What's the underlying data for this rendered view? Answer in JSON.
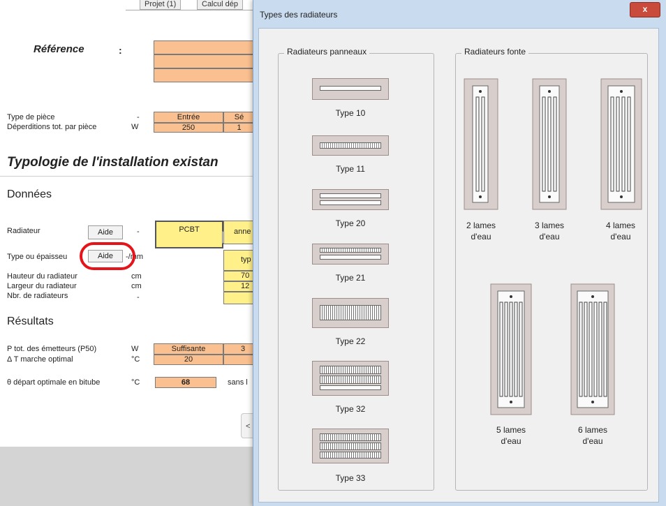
{
  "sheet": {
    "tabs": [
      "Projet (1)",
      "Calcul dép"
    ],
    "reference_label": "Référence",
    "reference_colon": ":",
    "type_piece_label": "Type de pièce",
    "type_piece_unit": "-",
    "type_piece_values": [
      "Entrée",
      "Sé"
    ],
    "deperditions_label": "Déperditions tot. par pièce",
    "deperditions_unit": "W",
    "deperditions_values": [
      "250",
      "1"
    ],
    "section_title": "Typologie de l'installation existan",
    "donnees_title": "Données",
    "radiateur_label": "Radiateur",
    "aide_label": "Aide",
    "radiateur_unit": "-",
    "radiateur_value": "PCBT",
    "radiateur_next": "anne",
    "type_epaisseur_label": "Type ou épaisseu",
    "type_epaisseur_unit": "-/mm",
    "type_epaisseur_value": "typ",
    "hauteur_label": "Hauteur du radiateur",
    "hauteur_unit": "cm",
    "hauteur_value": "70",
    "largeur_label": "Largeur du radiateur",
    "largeur_unit": "cm",
    "largeur_value": "12",
    "nbr_label": "Nbr. de radiateurs",
    "nbr_unit": "-",
    "resultats_title": "Résultats",
    "ptot_label": "P tot. des émetteurs (P50)",
    "ptot_unit": "W",
    "ptot_value": "Suffisante",
    "ptot_value2": "3",
    "deltat_label": "Δ T marche optimal",
    "deltat_unit": "°C",
    "deltat_value": "20",
    "theta_label": "θ départ optimale en bitube",
    "theta_unit": "°C",
    "theta_value": "68",
    "theta_note": "sans l"
  },
  "dialog": {
    "title": "Types des radiateurs",
    "close_label": "x",
    "panneaux_group": "Radiateurs panneaux",
    "fonte_group": "Radiateurs fonte",
    "panneaux": [
      "Type 10",
      "Type 11",
      "Type 20",
      "Type 21",
      "Type 22",
      "Type 32",
      "Type 33"
    ],
    "fonte": [
      {
        "line1": "2 lames",
        "line2": "d'eau"
      },
      {
        "line1": "3 lames",
        "line2": "d'eau"
      },
      {
        "line1": "4 lames",
        "line2": "d'eau"
      },
      {
        "line1": "5 lames",
        "line2": "d'eau"
      },
      {
        "line1": "6 lames",
        "line2": "d'eau"
      }
    ]
  },
  "colors": {
    "cell_orange": "#fac090",
    "cell_yellow": "#fff08a",
    "highlight_ring": "#e5141b",
    "close_button": "#c94b3c",
    "dialog_frame": "#c9dbee"
  }
}
